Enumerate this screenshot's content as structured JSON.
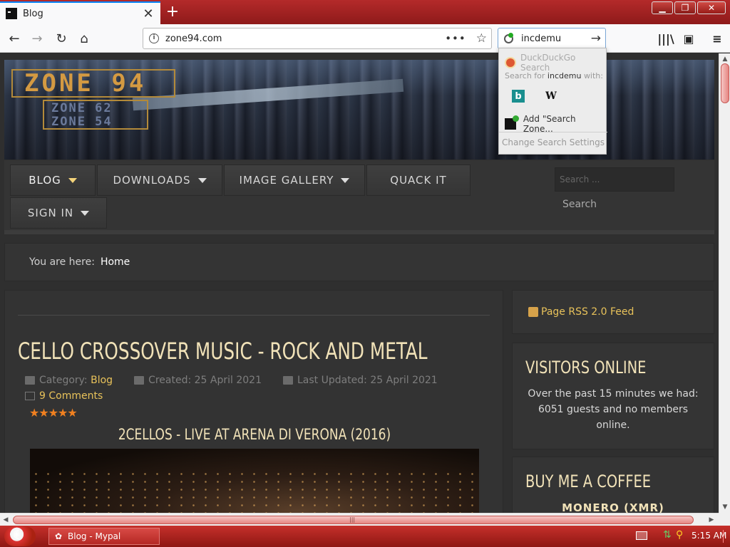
{
  "browser": {
    "tab_title": "Blog",
    "url": "zone94.com",
    "search_value": "incdemu"
  },
  "search_popup": {
    "default_engine": "DuckDuckGo Search",
    "search_for_prefix": "Search for",
    "search_for_query": "incdemu",
    "search_for_suffix": "with:",
    "engines": [
      "Bing",
      "Wikipedia"
    ],
    "add_engine": "Add \"Search Zone...",
    "change_settings": "Change Search Settings"
  },
  "site": {
    "logo_primary": "ZONE 94",
    "logo_secondary_1": "ZONE 62",
    "logo_secondary_2": "ZONE 54",
    "menu": [
      {
        "label": "BLOG",
        "has_dropdown": true
      },
      {
        "label": "DOWNLOADS",
        "has_dropdown": true
      },
      {
        "label": "IMAGE GALLERY",
        "has_dropdown": true
      },
      {
        "label": "QUACK IT",
        "has_dropdown": false
      },
      {
        "label": "SIGN IN",
        "has_dropdown": true
      }
    ],
    "search_placeholder": "Search ...",
    "search_button": "Search",
    "breadcrumb_label": "You are here:",
    "breadcrumb_home": "Home"
  },
  "article": {
    "title": "CELLO CROSSOVER MUSIC - ROCK AND METAL",
    "category_label": "Category:",
    "category": "Blog",
    "created": "Created: 25 April 2021",
    "updated": "Last Updated: 25 April 2021",
    "comments": "9 Comments",
    "rating": 5,
    "stars": "★★★★★",
    "subtitle": "2CELLOS - LIVE AT ARENA DI VERONA (2016)"
  },
  "sidebar": {
    "rss": "Page RSS 2.0 Feed",
    "visitors_title": "VISITORS ONLINE",
    "visitors_text": "Over the past 15 minutes we had: 6051 guests and no members online.",
    "coffee_title": "BUY ME A COFFEE",
    "coffee_sub": "MONERO (XMR)"
  },
  "taskbar": {
    "window_label": "Blog - Mypal",
    "clock": "5:15 AM"
  },
  "colors": {
    "accent_gold": "#f1e2b8",
    "link_yellow": "#e8c25a",
    "chrome_red": "#b42a2a",
    "star_orange": "#f08020"
  }
}
